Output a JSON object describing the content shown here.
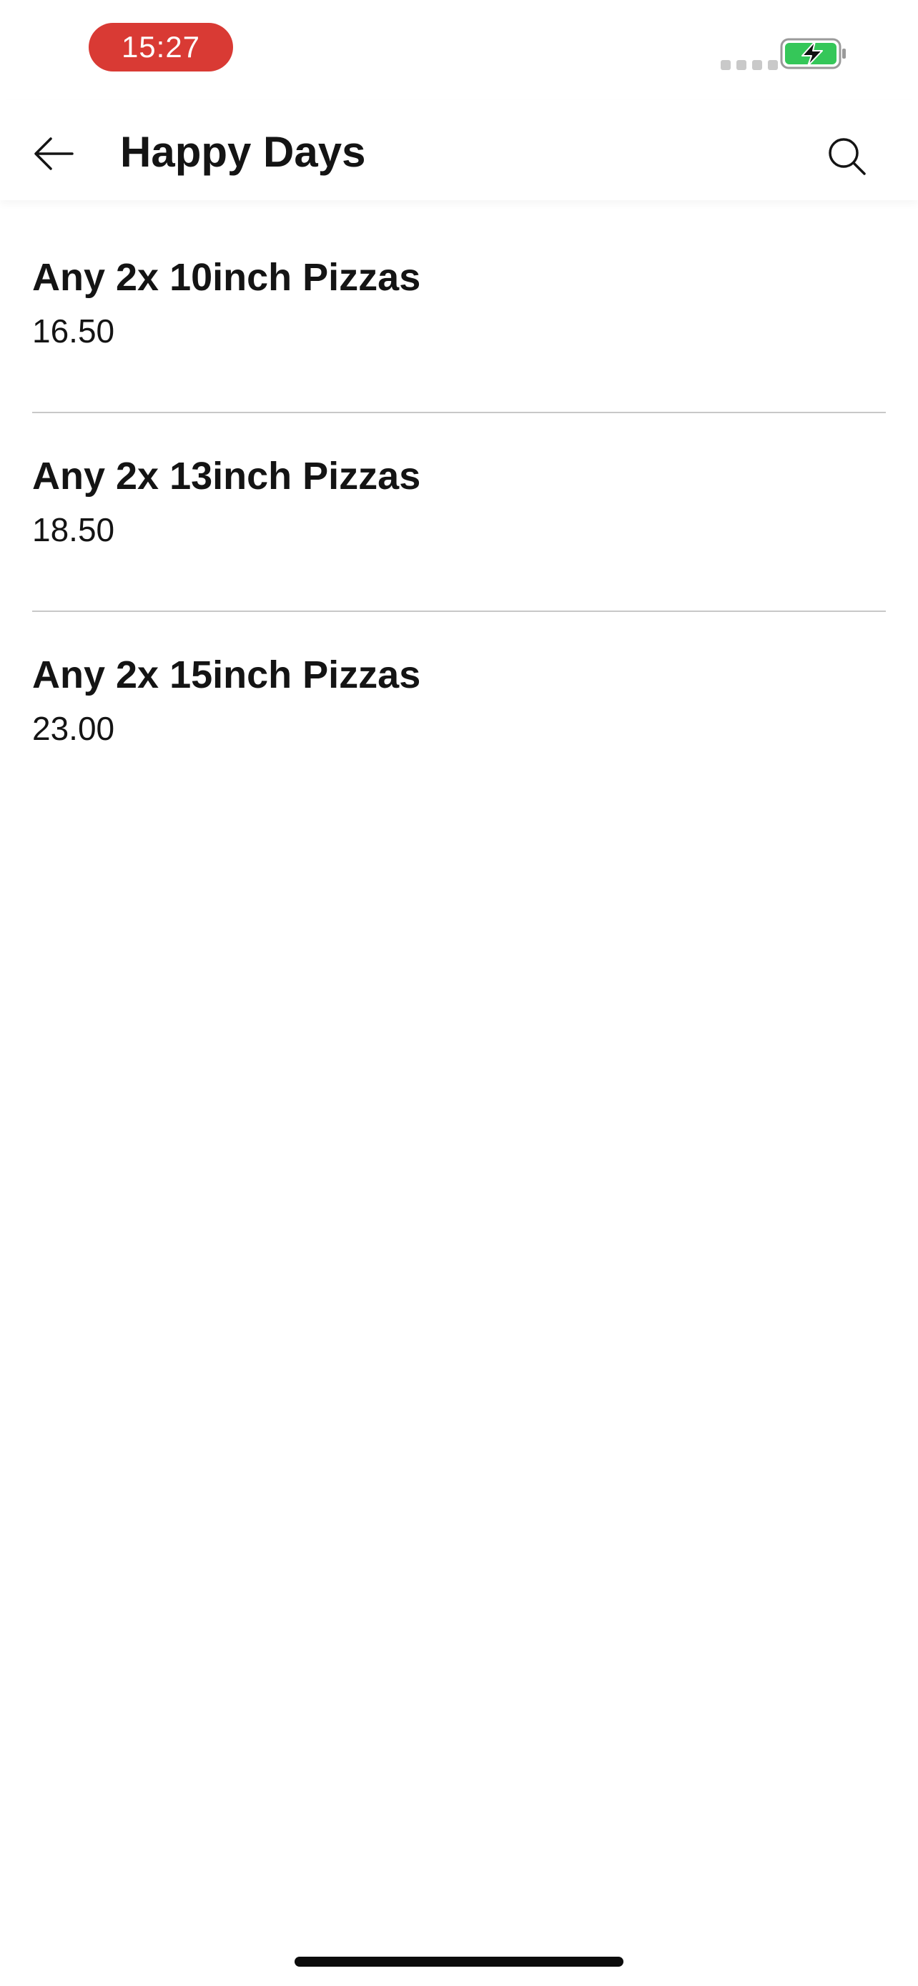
{
  "status_bar": {
    "time": "15:27",
    "colors": {
      "time_pill": "#d93a34",
      "battery_fill": "#35c759"
    },
    "battery_icon": "battery-charging-icon"
  },
  "header": {
    "title": "Happy Days",
    "back_icon": "arrow-left-icon",
    "search_icon": "search-icon"
  },
  "items": [
    {
      "name": "Any 2x 10inch Pizzas",
      "price": "16.50"
    },
    {
      "name": "Any 2x 13inch Pizzas",
      "price": "18.50"
    },
    {
      "name": "Any 2x 15inch Pizzas",
      "price": "23.00"
    }
  ]
}
